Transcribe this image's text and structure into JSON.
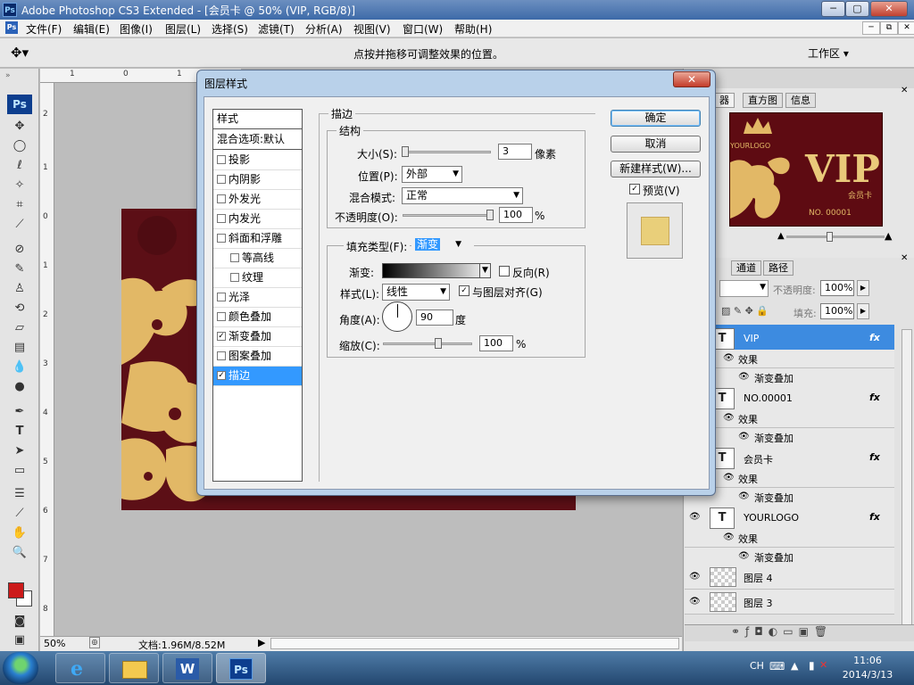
{
  "app": {
    "title": "Adobe Photoshop CS3 Extended - [会员卡 @ 50% (VIP, RGB/8)]",
    "ps_icon": "Ps"
  },
  "window_controls": [
    "─",
    "▢",
    "✕"
  ],
  "mdi_controls": [
    "─",
    "⧉",
    "✕"
  ],
  "menu": [
    "文件(F)",
    "编辑(E)",
    "图像(I)",
    "图层(L)",
    "选择(S)",
    "滤镜(T)",
    "分析(A)",
    "视图(V)",
    "窗口(W)",
    "帮助(H)"
  ],
  "options_bar": {
    "hint": "点按并拖移可调整效果的位置。",
    "workspace": "工作区 ▾"
  },
  "rulers": {
    "top": [
      "1",
      "0",
      "1"
    ],
    "left": [
      "2",
      "1",
      "0",
      "1",
      "2",
      "3",
      "4",
      "5",
      "6",
      "7",
      "8"
    ]
  },
  "canvas_text": {
    "logo_partial": "YO"
  },
  "statusbar": {
    "zoom": "50%",
    "doc": "文档:1.96M/8.52M"
  },
  "panels": {
    "top_tabs": [
      "器",
      "直方图",
      "信息"
    ],
    "vip_card": {
      "logo": "YOURLOGO",
      "vip": "VIP",
      "member": "会员卡",
      "number": "NO. 00001"
    },
    "layer_tabs": [
      "通道",
      "路径"
    ],
    "opacity_label": "不透明度:",
    "opacity_value": "100%",
    "fill_label": "填充:",
    "fill_value": "100%",
    "effects_label": "效果",
    "gradient_overlay": "渐变叠加",
    "fx": "fx",
    "text_thumb": "T",
    "layers": [
      {
        "name": "VIP",
        "type": "text",
        "selected": true
      },
      {
        "name": "NO.00001",
        "type": "text",
        "selected": false
      },
      {
        "name": "会员卡",
        "type": "text",
        "selected": false
      },
      {
        "name": "YOURLOGO",
        "type": "text",
        "selected": false
      },
      {
        "name": "图层 4",
        "type": "raster",
        "selected": false
      },
      {
        "name": "图层 3",
        "type": "raster",
        "selected": false
      }
    ]
  },
  "dialog": {
    "title": "图层样式",
    "close": "✕",
    "styles_header": "样式",
    "blend_default": "混合选项:默认",
    "style_items": [
      {
        "label": "投影",
        "checked": false,
        "indent": false
      },
      {
        "label": "内阴影",
        "checked": false,
        "indent": false
      },
      {
        "label": "外发光",
        "checked": false,
        "indent": false
      },
      {
        "label": "内发光",
        "checked": false,
        "indent": false
      },
      {
        "label": "斜面和浮雕",
        "checked": false,
        "indent": false
      },
      {
        "label": "等高线",
        "checked": false,
        "indent": true
      },
      {
        "label": "纹理",
        "checked": false,
        "indent": true
      },
      {
        "label": "光泽",
        "checked": false,
        "indent": false
      },
      {
        "label": "颜色叠加",
        "checked": false,
        "indent": false
      },
      {
        "label": "渐变叠加",
        "checked": true,
        "indent": false
      },
      {
        "label": "图案叠加",
        "checked": false,
        "indent": false
      },
      {
        "label": "描边",
        "checked": true,
        "indent": false
      }
    ],
    "stroke_group": "描边",
    "structure_group": "结构",
    "size_label": "大小(S):",
    "size_value": "3",
    "size_unit": "像素",
    "position_label": "位置(P):",
    "position_value": "外部",
    "blend_mode_label": "混合模式:",
    "blend_mode_value": "正常",
    "opacity_label": "不透明度(O):",
    "opacity_value": "100",
    "opacity_unit": "%",
    "fill_type_label": "填充类型(F):",
    "fill_type_value": "渐变",
    "gradient_label": "渐变:",
    "reverse_label": "反向(R)",
    "reverse_checked": false,
    "style_label": "样式(L):",
    "style_value": "线性",
    "align_label": "与图层对齐(G)",
    "align_checked": true,
    "angle_label": "角度(A):",
    "angle_value": "90",
    "angle_unit": "度",
    "scale_label": "缩放(C):",
    "scale_value": "100",
    "scale_unit": "%",
    "ok": "确定",
    "cancel": "取消",
    "new_style": "新建样式(W)...",
    "preview_label": "预览(V)",
    "preview_checked": true,
    "preview_color": "#e9cf7a"
  },
  "taskbar": {
    "lang": "CH",
    "time": "11:06",
    "date": "2014/3/13",
    "apps": [
      "ie",
      "explorer",
      "word",
      "photoshop"
    ],
    "word_label": "W",
    "ps_label": "Ps"
  },
  "colors": {
    "card_bg": "#5c0f16",
    "gold": "#e2b866",
    "selection": "#3399ff"
  }
}
